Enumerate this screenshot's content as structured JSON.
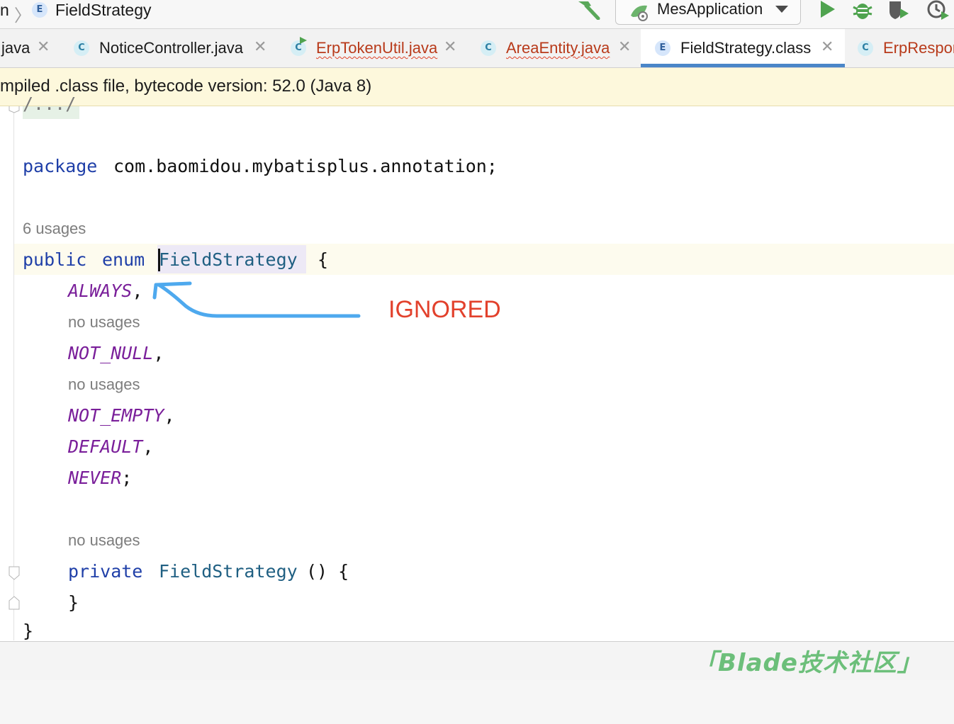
{
  "breadcrumb": {
    "parent_fragment": "n",
    "badge": "E",
    "current": "FieldStrategy"
  },
  "toolbar": {
    "run_configuration": "MesApplication",
    "icons": [
      "hammer-icon",
      "spring-boot-icon",
      "dropdown-icon",
      "run-icon",
      "debug-icon",
      "coverage-icon",
      "profile-icon"
    ]
  },
  "tabs": [
    {
      "label": "java",
      "badge": "",
      "error": false,
      "active": false
    },
    {
      "label": "NoticeController.java",
      "badge": "C",
      "error": false,
      "active": false
    },
    {
      "label": "ErpTokenUtil.java",
      "badge": "C",
      "error": true,
      "active": false
    },
    {
      "label": "AreaEntity.java",
      "badge": "C",
      "error": true,
      "active": false
    },
    {
      "label": "FieldStrategy.class",
      "badge": "E",
      "error": false,
      "active": true
    },
    {
      "label": "ErpRespor",
      "badge": "C",
      "error": true,
      "active": false
    }
  ],
  "notice": {
    "text": "mpiled .class file, bytecode version: 52.0 (Java 8)"
  },
  "code": {
    "folded_comment": "/.../",
    "package_kw": "package",
    "package_name": "com.baomidou.mybatisplus.annotation;",
    "enum_usages": "6 usages",
    "public_kw": "public",
    "enum_kw": "enum",
    "enum_name": "FieldStrategy",
    "open_brace": "{",
    "constants": [
      {
        "name": "ALWAYS",
        "punct": ",",
        "usages": "no usages"
      },
      {
        "name": "NOT_NULL",
        "punct": ",",
        "usages": "no usages"
      },
      {
        "name": "NOT_EMPTY",
        "punct": ",",
        "usages": ""
      },
      {
        "name": "DEFAULT",
        "punct": ",",
        "usages": ""
      },
      {
        "name": "NEVER",
        "punct": ";",
        "usages": ""
      }
    ],
    "ctor_usages": "no usages",
    "private_kw": "private",
    "ctor_name": "FieldStrategy",
    "ctor_sig": "() {",
    "ctor_close": "}",
    "enum_close": "}"
  },
  "annotation": {
    "label": "IGNORED",
    "arrow_color": "#4ea9ee",
    "label_color": "#e2412c"
  },
  "watermark": "「Blade技术社区」",
  "colors": {
    "keyword": "#1f3fa8",
    "constant": "#7a1f9a",
    "class_name": "#1f5f82",
    "notice_bg": "#fdf8dc",
    "active_tab_underline": "#4a86c8"
  }
}
